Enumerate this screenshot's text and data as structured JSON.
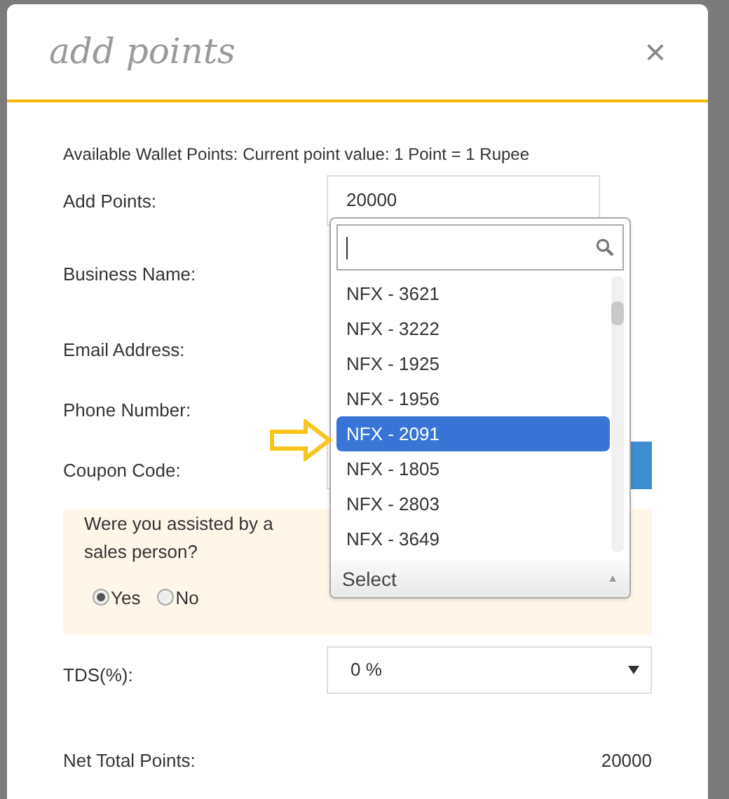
{
  "dialog": {
    "title": "add points",
    "close": "×"
  },
  "info": "Available Wallet Points: Current point value: 1 Point = 1 Rupee",
  "fields": [
    {
      "label": "Add Points:",
      "kind": "input",
      "value": "20000"
    },
    {
      "label": "Business Name:",
      "kind": "hidden"
    },
    {
      "label": "Email Address:",
      "kind": "hidden"
    },
    {
      "label": "Phone Number:",
      "kind": "hidden"
    },
    {
      "label": "Coupon Code:",
      "kind": "coupon"
    }
  ],
  "assist": {
    "question": "Were you assisted by a sales person?",
    "options": [
      {
        "label": "Yes",
        "selected": true
      },
      {
        "label": "No",
        "selected": false
      }
    ]
  },
  "tds": {
    "label": "TDS(%):",
    "value": "0 %"
  },
  "net_total": {
    "label": "Net Total Points:",
    "value": "20000"
  },
  "dropdown": {
    "items": [
      {
        "label": "NFX - 3621",
        "selected": false
      },
      {
        "label": "NFX - 3222",
        "selected": false
      },
      {
        "label": "NFX - 1925",
        "selected": false
      },
      {
        "label": "NFX - 1956",
        "selected": false
      },
      {
        "label": "NFX - 2091",
        "selected": true
      },
      {
        "label": "NFX - 1805",
        "selected": false
      },
      {
        "label": "NFX - 2803",
        "selected": false
      },
      {
        "label": "NFX - 3649",
        "selected": false
      }
    ],
    "current": "Select",
    "caret": "▲"
  }
}
